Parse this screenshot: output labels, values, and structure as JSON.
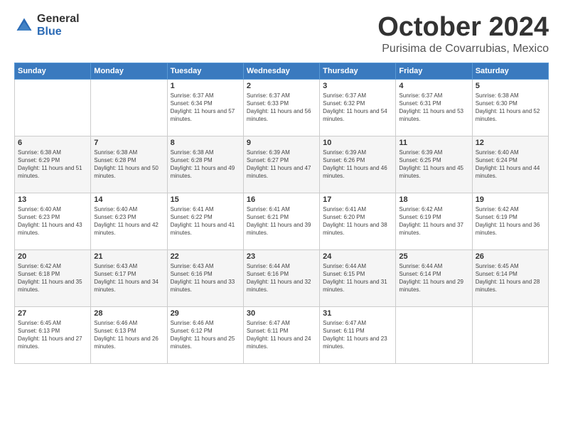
{
  "header": {
    "logo_general": "General",
    "logo_blue": "Blue",
    "month": "October 2024",
    "location": "Purisima de Covarrubias, Mexico"
  },
  "weekdays": [
    "Sunday",
    "Monday",
    "Tuesday",
    "Wednesday",
    "Thursday",
    "Friday",
    "Saturday"
  ],
  "weeks": [
    [
      {
        "day": "",
        "info": ""
      },
      {
        "day": "",
        "info": ""
      },
      {
        "day": "1",
        "info": "Sunrise: 6:37 AM\nSunset: 6:34 PM\nDaylight: 11 hours and 57 minutes."
      },
      {
        "day": "2",
        "info": "Sunrise: 6:37 AM\nSunset: 6:33 PM\nDaylight: 11 hours and 56 minutes."
      },
      {
        "day": "3",
        "info": "Sunrise: 6:37 AM\nSunset: 6:32 PM\nDaylight: 11 hours and 54 minutes."
      },
      {
        "day": "4",
        "info": "Sunrise: 6:37 AM\nSunset: 6:31 PM\nDaylight: 11 hours and 53 minutes."
      },
      {
        "day": "5",
        "info": "Sunrise: 6:38 AM\nSunset: 6:30 PM\nDaylight: 11 hours and 52 minutes."
      }
    ],
    [
      {
        "day": "6",
        "info": "Sunrise: 6:38 AM\nSunset: 6:29 PM\nDaylight: 11 hours and 51 minutes."
      },
      {
        "day": "7",
        "info": "Sunrise: 6:38 AM\nSunset: 6:28 PM\nDaylight: 11 hours and 50 minutes."
      },
      {
        "day": "8",
        "info": "Sunrise: 6:38 AM\nSunset: 6:28 PM\nDaylight: 11 hours and 49 minutes."
      },
      {
        "day": "9",
        "info": "Sunrise: 6:39 AM\nSunset: 6:27 PM\nDaylight: 11 hours and 47 minutes."
      },
      {
        "day": "10",
        "info": "Sunrise: 6:39 AM\nSunset: 6:26 PM\nDaylight: 11 hours and 46 minutes."
      },
      {
        "day": "11",
        "info": "Sunrise: 6:39 AM\nSunset: 6:25 PM\nDaylight: 11 hours and 45 minutes."
      },
      {
        "day": "12",
        "info": "Sunrise: 6:40 AM\nSunset: 6:24 PM\nDaylight: 11 hours and 44 minutes."
      }
    ],
    [
      {
        "day": "13",
        "info": "Sunrise: 6:40 AM\nSunset: 6:23 PM\nDaylight: 11 hours and 43 minutes."
      },
      {
        "day": "14",
        "info": "Sunrise: 6:40 AM\nSunset: 6:23 PM\nDaylight: 11 hours and 42 minutes."
      },
      {
        "day": "15",
        "info": "Sunrise: 6:41 AM\nSunset: 6:22 PM\nDaylight: 11 hours and 41 minutes."
      },
      {
        "day": "16",
        "info": "Sunrise: 6:41 AM\nSunset: 6:21 PM\nDaylight: 11 hours and 39 minutes."
      },
      {
        "day": "17",
        "info": "Sunrise: 6:41 AM\nSunset: 6:20 PM\nDaylight: 11 hours and 38 minutes."
      },
      {
        "day": "18",
        "info": "Sunrise: 6:42 AM\nSunset: 6:19 PM\nDaylight: 11 hours and 37 minutes."
      },
      {
        "day": "19",
        "info": "Sunrise: 6:42 AM\nSunset: 6:19 PM\nDaylight: 11 hours and 36 minutes."
      }
    ],
    [
      {
        "day": "20",
        "info": "Sunrise: 6:42 AM\nSunset: 6:18 PM\nDaylight: 11 hours and 35 minutes."
      },
      {
        "day": "21",
        "info": "Sunrise: 6:43 AM\nSunset: 6:17 PM\nDaylight: 11 hours and 34 minutes."
      },
      {
        "day": "22",
        "info": "Sunrise: 6:43 AM\nSunset: 6:16 PM\nDaylight: 11 hours and 33 minutes."
      },
      {
        "day": "23",
        "info": "Sunrise: 6:44 AM\nSunset: 6:16 PM\nDaylight: 11 hours and 32 minutes."
      },
      {
        "day": "24",
        "info": "Sunrise: 6:44 AM\nSunset: 6:15 PM\nDaylight: 11 hours and 31 minutes."
      },
      {
        "day": "25",
        "info": "Sunrise: 6:44 AM\nSunset: 6:14 PM\nDaylight: 11 hours and 29 minutes."
      },
      {
        "day": "26",
        "info": "Sunrise: 6:45 AM\nSunset: 6:14 PM\nDaylight: 11 hours and 28 minutes."
      }
    ],
    [
      {
        "day": "27",
        "info": "Sunrise: 6:45 AM\nSunset: 6:13 PM\nDaylight: 11 hours and 27 minutes."
      },
      {
        "day": "28",
        "info": "Sunrise: 6:46 AM\nSunset: 6:13 PM\nDaylight: 11 hours and 26 minutes."
      },
      {
        "day": "29",
        "info": "Sunrise: 6:46 AM\nSunset: 6:12 PM\nDaylight: 11 hours and 25 minutes."
      },
      {
        "day": "30",
        "info": "Sunrise: 6:47 AM\nSunset: 6:11 PM\nDaylight: 11 hours and 24 minutes."
      },
      {
        "day": "31",
        "info": "Sunrise: 6:47 AM\nSunset: 6:11 PM\nDaylight: 11 hours and 23 minutes."
      },
      {
        "day": "",
        "info": ""
      },
      {
        "day": "",
        "info": ""
      }
    ]
  ]
}
